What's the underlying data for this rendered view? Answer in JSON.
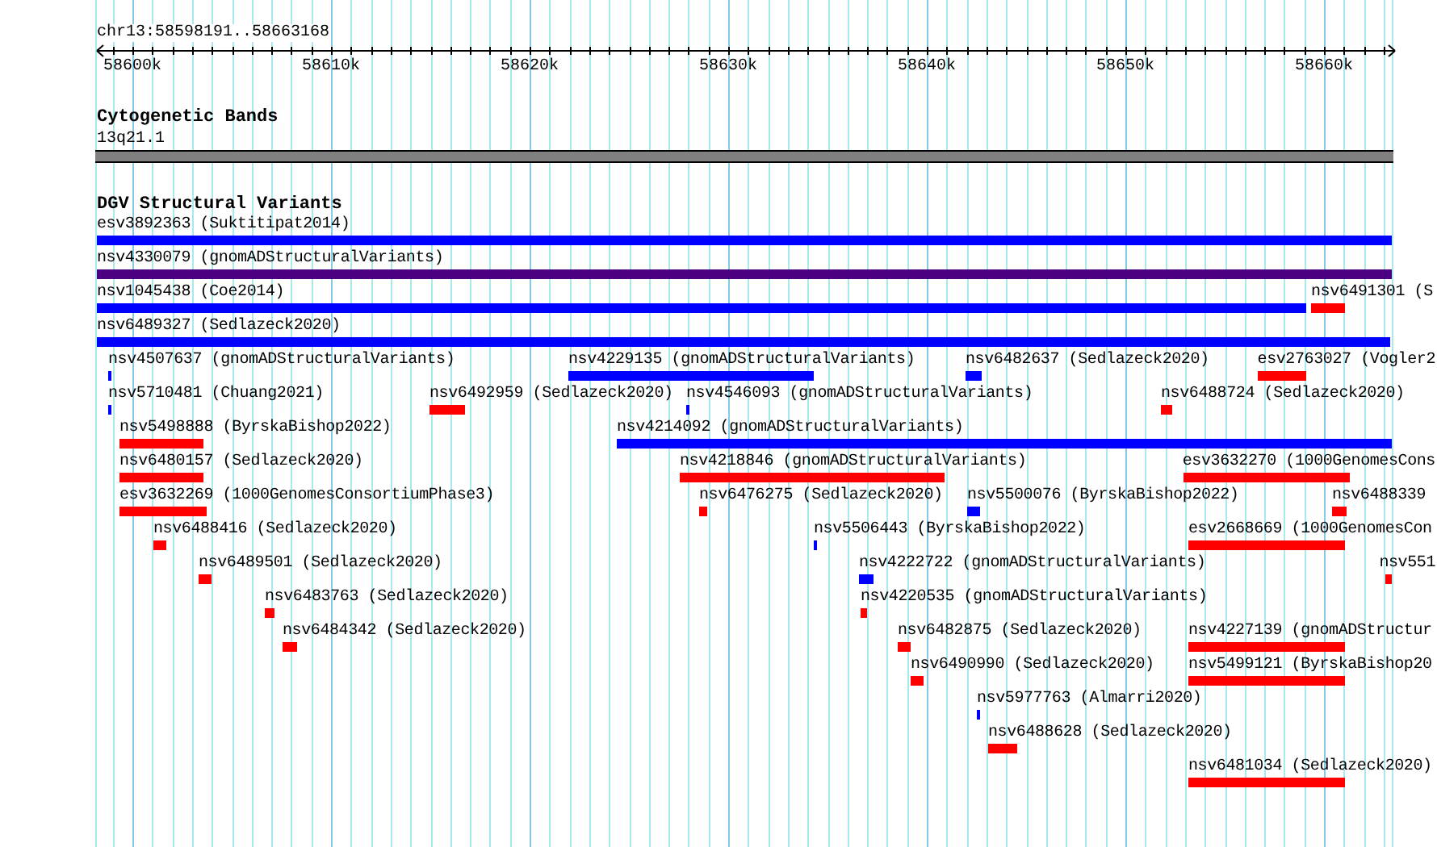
{
  "ruler": {
    "region": "chr13:58598191..58663168",
    "tick_labels": [
      "58600k",
      "58610k",
      "58620k",
      "58630k",
      "58640k",
      "58650k",
      "58660k"
    ]
  },
  "cytogenetic_track": {
    "title": "Cytogenetic Bands",
    "band": "13q21.1"
  },
  "variant_track": {
    "title": "DGV Structural Variants",
    "rows": [
      [
        {
          "label": "esv3892363 (Suktitipat2014)",
          "color": "#0000ff"
        }
      ],
      [
        {
          "label": "nsv4330079 (gnomADStructuralVariants)",
          "color": "#4b0082"
        }
      ],
      [
        {
          "label": "nsv1045438 (Coe2014)",
          "color": "#0000ff"
        },
        {
          "label": "nsv6491301 (S",
          "color": "#ff0000"
        }
      ],
      [
        {
          "label": "nsv6489327 (Sedlazeck2020)",
          "color": "#0000ff"
        }
      ],
      [
        {
          "label": "nsv4507637 (gnomADStructuralVariants)",
          "color": "#0000ff"
        },
        {
          "label": "nsv4229135 (gnomADStructuralVariants)",
          "color": "#0000ff"
        },
        {
          "label": "nsv6482637 (Sedlazeck2020)",
          "color": "#0000ff"
        },
        {
          "label": "esv2763027 (Vogler2",
          "color": "#ff0000"
        }
      ],
      [
        {
          "label": "nsv5710481 (Chuang2021)",
          "color": "#0000ff"
        },
        {
          "label": "nsv6492959 (Sedlazeck2020)",
          "color": "#ff0000"
        },
        {
          "label": "nsv4546093 (gnomADStructuralVariants)",
          "color": "#0000ff"
        },
        {
          "label": "nsv6488724 (Sedlazeck2020)",
          "color": "#ff0000"
        }
      ],
      [
        {
          "label": "nsv5498888 (ByrskaBishop2022)",
          "color": "#ff0000"
        },
        {
          "label": "nsv4214092 (gnomADStructuralVariants)",
          "color": "#0000ff"
        }
      ],
      [
        {
          "label": "nsv6480157 (Sedlazeck2020)",
          "color": "#ff0000"
        },
        {
          "label": "nsv4218846 (gnomADStructuralVariants)",
          "color": "#ff0000"
        },
        {
          "label": "esv3632270 (1000GenomesCons",
          "color": "#ff0000"
        }
      ],
      [
        {
          "label": "esv3632269 (1000GenomesConsortiumPhase3)",
          "color": "#ff0000"
        },
        {
          "label": "nsv6476275 (Sedlazeck2020)",
          "color": "#ff0000"
        },
        {
          "label": "nsv5500076 (ByrskaBishop2022)",
          "color": "#0000ff"
        },
        {
          "label": "nsv6488339",
          "color": "#ff0000"
        }
      ],
      [
        {
          "label": "nsv6488416 (Sedlazeck2020)",
          "color": "#ff0000"
        },
        {
          "label": "nsv5506443 (ByrskaBishop2022)",
          "color": "#0000ff"
        },
        {
          "label": "esv2668669 (1000GenomesCon",
          "color": "#ff0000"
        }
      ],
      [
        {
          "label": "nsv6489501 (Sedlazeck2020)",
          "color": "#ff0000"
        },
        {
          "label": "nsv4222722 (gnomADStructuralVariants)",
          "color": "#0000ff"
        },
        {
          "label": "nsv551",
          "color": "#ff0000"
        }
      ],
      [
        {
          "label": "nsv6483763 (Sedlazeck2020)",
          "color": "#ff0000"
        },
        {
          "label": "nsv4220535 (gnomADStructuralVariants)",
          "color": "#ff0000"
        }
      ],
      [
        {
          "label": "nsv6484342 (Sedlazeck2020)",
          "color": "#ff0000"
        },
        {
          "label": "nsv6482875 (Sedlazeck2020)",
          "color": "#ff0000"
        },
        {
          "label": "nsv4227139 (gnomADStructur",
          "color": "#ff0000"
        }
      ],
      [
        {
          "label": "nsv6490990 (Sedlazeck2020)",
          "color": "#ff0000"
        },
        {
          "label": "nsv5499121 (ByrskaBishop20",
          "color": "#ff0000"
        }
      ],
      [
        {
          "label": "nsv5977763 (Almarri2020)",
          "color": "#0000ff"
        }
      ],
      [
        {
          "label": "nsv6488628 (Sedlazeck2020)",
          "color": "#ff0000"
        }
      ],
      [
        {
          "label": "nsv6481034 (Sedlazeck2020)",
          "color": "#ff0000"
        }
      ]
    ]
  }
}
